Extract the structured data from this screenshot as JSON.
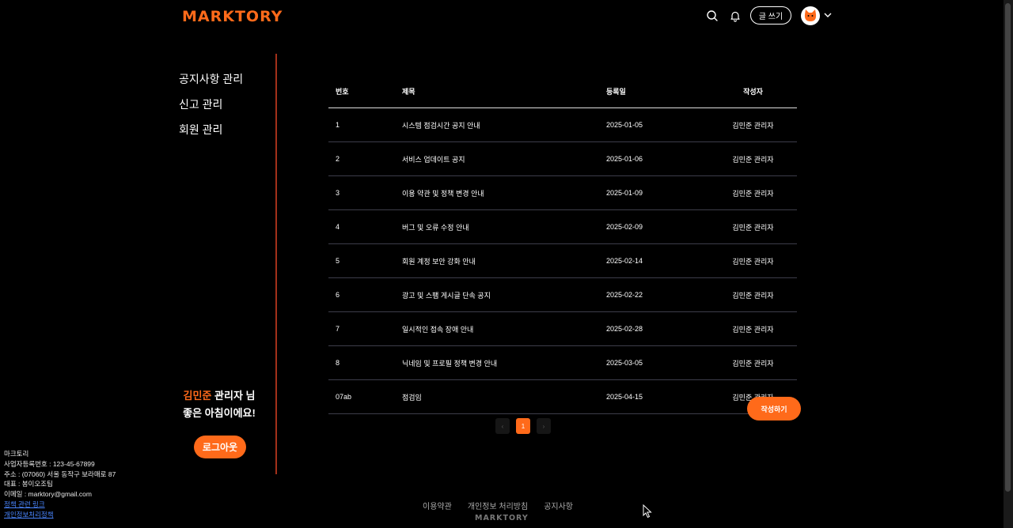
{
  "header": {
    "logo": "MARKTORY",
    "write_label": "글 쓰기",
    "icons": [
      "search-icon",
      "bell-icon",
      "chevron-down-icon"
    ]
  },
  "sidebar": {
    "items": [
      {
        "label": "공지사항 관리"
      },
      {
        "label": "신고 관리"
      },
      {
        "label": "회원 관리"
      }
    ],
    "user_name": "김민준",
    "greeting_suffix": "관리자 님",
    "greeting_line2": "좋은 아침이에요!",
    "logout_label": "로그아웃"
  },
  "company": {
    "name": "마크토리",
    "reg": "사업자등록번호 : 123-45-67899",
    "address": "주소 : (07060) 서울 동작구 보라매로 87",
    "ceo": "대표 : 봉이오조팀",
    "email": "이메일 : marktory@gmail.com",
    "link1": "정책 관련 링크",
    "link2": "개인정보처리정책"
  },
  "table": {
    "headers": [
      "번호",
      "제목",
      "등록일",
      "작성자"
    ],
    "rows": [
      {
        "no": "1",
        "title": "시스템 점검시간 공지 안내",
        "date": "2025-01-05",
        "author": "김민준 관리자"
      },
      {
        "no": "2",
        "title": "서비스 업데이트 공지",
        "date": "2025-01-06",
        "author": "김민준 관리자"
      },
      {
        "no": "3",
        "title": "이용 약관 및 정책 변경 안내",
        "date": "2025-01-09",
        "author": "김민준 관리자"
      },
      {
        "no": "4",
        "title": "버그 및 오류 수정 안내",
        "date": "2025-02-09",
        "author": "김민준 관리자"
      },
      {
        "no": "5",
        "title": "회원 계정 보안 강화 안내",
        "date": "2025-02-14",
        "author": "김민준 관리자"
      },
      {
        "no": "6",
        "title": "광고 및 스팸 게시글 단속 공지",
        "date": "2025-02-22",
        "author": "김민준 관리자"
      },
      {
        "no": "7",
        "title": "일시적인 접속 장애 안내",
        "date": "2025-02-28",
        "author": "김민준 관리자"
      },
      {
        "no": "8",
        "title": "닉네임 및 프로필 정책 변경 안내",
        "date": "2025-03-05",
        "author": "김민준 관리자"
      },
      {
        "no": "07ab",
        "title": "점검임",
        "date": "2025-04-15",
        "author": "김민준 관리자"
      }
    ]
  },
  "pagination": {
    "prev": "‹",
    "current": "1",
    "next": "›"
  },
  "post_button": "작성하기",
  "footer": {
    "links": [
      "이용약관",
      "개인정보 처리방침",
      "공지사항"
    ],
    "logo": "MARKTORY"
  },
  "colors": {
    "accent": "#ff6a1a",
    "divider": "#a2301a",
    "background": "#000000"
  }
}
